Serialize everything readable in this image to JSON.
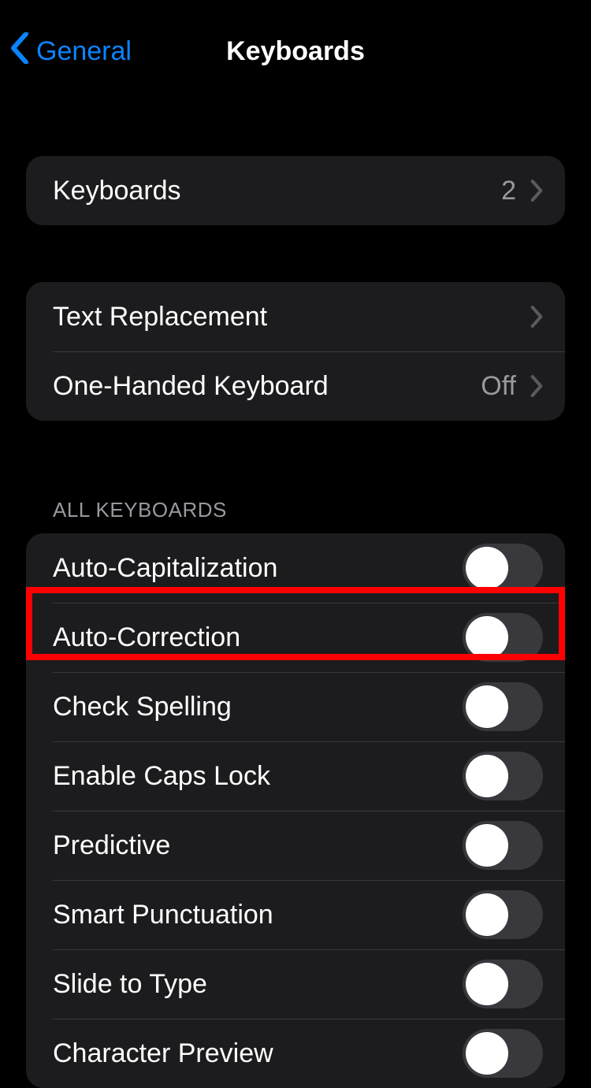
{
  "nav": {
    "back_label": "General",
    "title": "Keyboards"
  },
  "group1": {
    "keyboards_label": "Keyboards",
    "keyboards_count": "2"
  },
  "group2": {
    "text_replacement_label": "Text Replacement",
    "one_handed_label": "One-Handed Keyboard",
    "one_handed_value": "Off"
  },
  "section_all_keyboards": "ALL KEYBOARDS",
  "toggles": {
    "auto_cap": "Auto-Capitalization",
    "auto_correct": "Auto-Correction",
    "check_spelling": "Check Spelling",
    "caps_lock": "Enable Caps Lock",
    "predictive": "Predictive",
    "smart_punct": "Smart Punctuation",
    "slide_type": "Slide to Type",
    "char_preview": "Character Preview"
  },
  "toggle_states": {
    "auto_cap": false,
    "auto_correct": false,
    "check_spelling": false,
    "caps_lock": false,
    "predictive": false,
    "smart_punct": false,
    "slide_type": false,
    "char_preview": false
  },
  "highlight": {
    "target": "auto-correction-row"
  }
}
